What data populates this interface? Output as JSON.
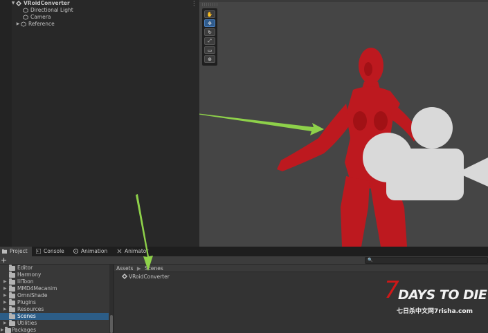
{
  "hierarchy": {
    "root": "VRoidConverter",
    "children": [
      "Directional Light",
      "Camera",
      "Reference"
    ]
  },
  "scene_tools": [
    {
      "icon": "hand-icon",
      "glyph": "✋",
      "active": false
    },
    {
      "icon": "move-icon",
      "glyph": "✥",
      "active": true
    },
    {
      "icon": "rotate-icon",
      "glyph": "↻",
      "active": false
    },
    {
      "icon": "scale-icon",
      "glyph": "⤢",
      "active": false
    },
    {
      "icon": "rect-icon",
      "glyph": "▭",
      "active": false
    },
    {
      "icon": "transform-icon",
      "glyph": "⊕",
      "active": false
    }
  ],
  "tabs": [
    {
      "label": "Project",
      "icon": "folder-icon",
      "active": true
    },
    {
      "label": "Console",
      "icon": "console-icon",
      "active": false
    },
    {
      "label": "Animation",
      "icon": "animation-icon",
      "active": false
    },
    {
      "label": "Animator",
      "icon": "animator-icon",
      "active": false
    }
  ],
  "toolbar": {
    "add_label": "+ ▾",
    "search_placeholder": "🔍"
  },
  "folders": [
    {
      "label": "Editor",
      "expandable": false,
      "selected": false
    },
    {
      "label": "Harmony",
      "expandable": false,
      "selected": false
    },
    {
      "label": "lilToon",
      "expandable": true,
      "selected": false
    },
    {
      "label": "MMD4Mecanim",
      "expandable": true,
      "selected": false
    },
    {
      "label": "OmniShade",
      "expandable": true,
      "selected": false
    },
    {
      "label": "Plugins",
      "expandable": true,
      "selected": false
    },
    {
      "label": "Resources",
      "expandable": true,
      "selected": false
    },
    {
      "label": "Scenes",
      "expandable": false,
      "selected": true
    },
    {
      "label": "Utilities",
      "expandable": true,
      "selected": false
    },
    {
      "label": "Packages",
      "expandable": true,
      "selected": false
    }
  ],
  "breadcrumb": [
    "Assets",
    "Scenes"
  ],
  "assets": [
    {
      "label": "VRoidConverter",
      "icon": "unity-scene-icon"
    }
  ],
  "watermark": {
    "logo_number": "7",
    "logo_text": "DAYS TO DIE",
    "subtitle_cn": "七日杀中文网",
    "url": "7risha.com"
  },
  "colors": {
    "selection": "#2c5d87",
    "model": "#c8161c",
    "arrow": "#8ed14a",
    "watermark_red": "#d01818"
  }
}
